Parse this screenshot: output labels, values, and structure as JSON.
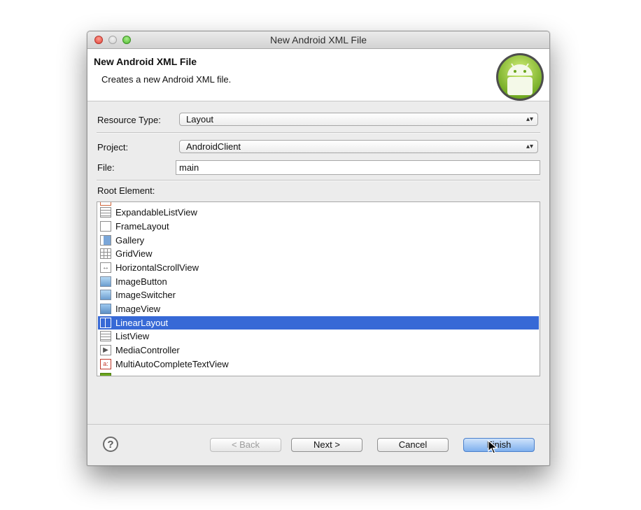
{
  "window": {
    "title": "New Android XML File",
    "controls": [
      "close",
      "minimize",
      "zoom"
    ]
  },
  "header": {
    "title": "New Android XML File",
    "description": "Creates a new Android XML file.",
    "logo_icon": "android-logo-icon"
  },
  "form": {
    "resource_type_label": "Resource Type:",
    "resource_type_value": "Layout",
    "project_label": "Project:",
    "project_value": "AndroidClient",
    "file_label": "File:",
    "file_value": "main",
    "root_element_label": "Root Element:"
  },
  "root_elements": [
    {
      "label": "ExpandableListView",
      "icon": "list-icon"
    },
    {
      "label": "FrameLayout",
      "icon": "frame-icon"
    },
    {
      "label": "Gallery",
      "icon": "gallery-icon"
    },
    {
      "label": "GridView",
      "icon": "grid-icon"
    },
    {
      "label": "HorizontalScrollView",
      "icon": "hscroll-icon"
    },
    {
      "label": "ImageButton",
      "icon": "image-button-icon"
    },
    {
      "label": "ImageSwitcher",
      "icon": "image-switcher-icon"
    },
    {
      "label": "ImageView",
      "icon": "image-icon"
    },
    {
      "label": "LinearLayout",
      "icon": "linear-layout-icon",
      "selected": true
    },
    {
      "label": "ListView",
      "icon": "list-icon"
    },
    {
      "label": "MediaController",
      "icon": "media-icon"
    },
    {
      "label": "MultiAutoCompleteTextView",
      "icon": "autocomplete-icon"
    }
  ],
  "buttons": {
    "help": "?",
    "back": "< Back",
    "next": "Next >",
    "cancel": "Cancel",
    "finish": "Finish"
  },
  "colors": {
    "selection": "#3769d6",
    "primary_button": "#7fb0ee"
  }
}
